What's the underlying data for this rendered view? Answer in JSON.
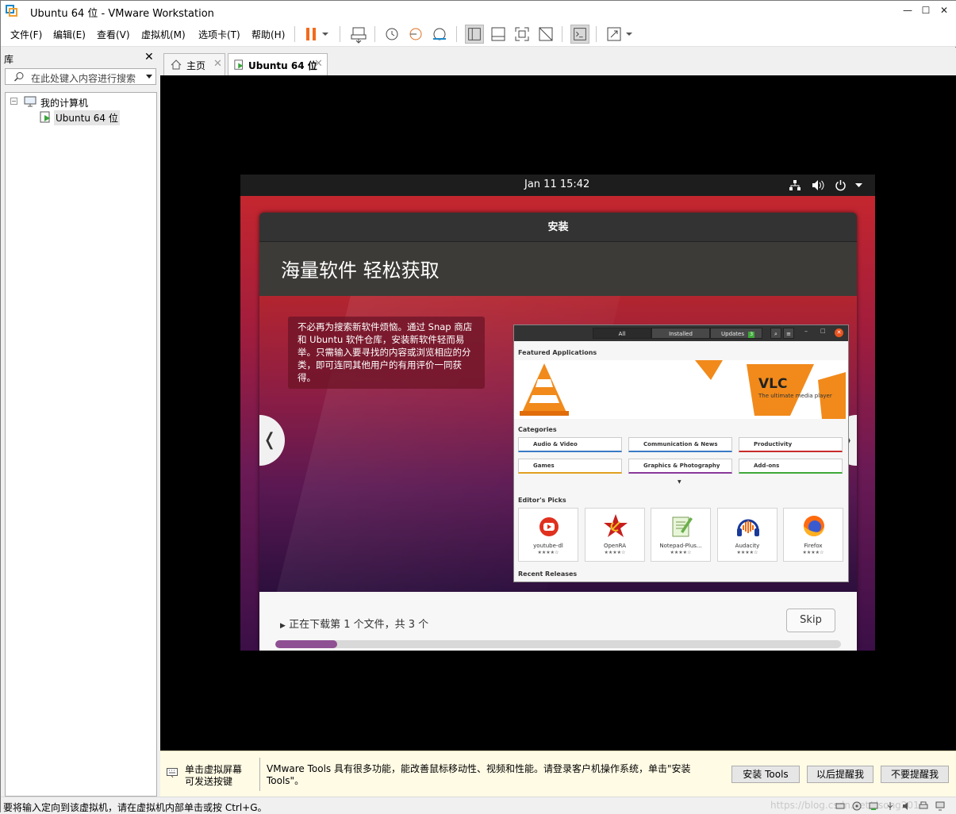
{
  "window": {
    "title": "Ubuntu 64 位 - VMware Workstation"
  },
  "menu": [
    "文件(F)",
    "编辑(E)",
    "查看(V)",
    "虚拟机(M)",
    "选项卡(T)",
    "帮助(H)"
  ],
  "library": {
    "header": "库",
    "search_placeholder": "在此处键入内容进行搜索",
    "tree_root": "我的计算机",
    "tree_vm": "Ubuntu 64 位"
  },
  "tabs": [
    {
      "label": "主页"
    },
    {
      "label": "Ubuntu 64 位"
    }
  ],
  "ubuntu": {
    "clock": "Jan 11  15:42",
    "dialog_title": "安装",
    "slide_title": "海量软件 轻松获取",
    "slide_text": "不必再为搜索新软件烦恼。通过 Snap 商店和 Ubuntu 软件仓库，安装新软件轻而易举。只需输入要寻找的内容或浏览相应的分类，即可连同其他用户的有用评价一同获得。",
    "screenshot": {
      "segments": [
        "All",
        "Installed",
        "Updates"
      ],
      "updates_badge": "3",
      "featured": "Featured Applications",
      "vlc_title": "VLC",
      "vlc_sub": "The ultimate media player",
      "categories_label": "Categories",
      "categories": [
        "Audio & Video",
        "Communication & News",
        "Productivity",
        "Games",
        "Graphics & Photography",
        "Add-ons"
      ],
      "editors_label": "Editor's Picks",
      "picks": [
        "youtube-dl",
        "OpenRA",
        "Notepad-Plus...",
        "Audacity",
        "Firefox"
      ],
      "stars": "★★★★☆",
      "recent": "Recent Releases"
    },
    "download_status": "正在下载第 1 个文件，共 3 个",
    "skip": "Skip",
    "progress": 0.11
  },
  "notice": {
    "left": "单击虚拟屏幕\n可发送按键",
    "message": "VMware Tools 具有很多功能，能改善鼠标移动性、视频和性能。请登录客户机操作系统，单击\"安装 Tools\"。",
    "btn_install": "安装 Tools",
    "btn_later": "以后提醒我",
    "btn_never": "不要提醒我"
  },
  "status": {
    "text": "要将输入定向到该虚拟机，请在虚拟机内部单击或按 Ctrl+G。",
    "watermark": "https://blog.csdn.net/dsong2012"
  },
  "colors": {
    "ubuntu_orange": "#e95420",
    "progress": "#8f4f93",
    "pause": "#f26b1d"
  }
}
